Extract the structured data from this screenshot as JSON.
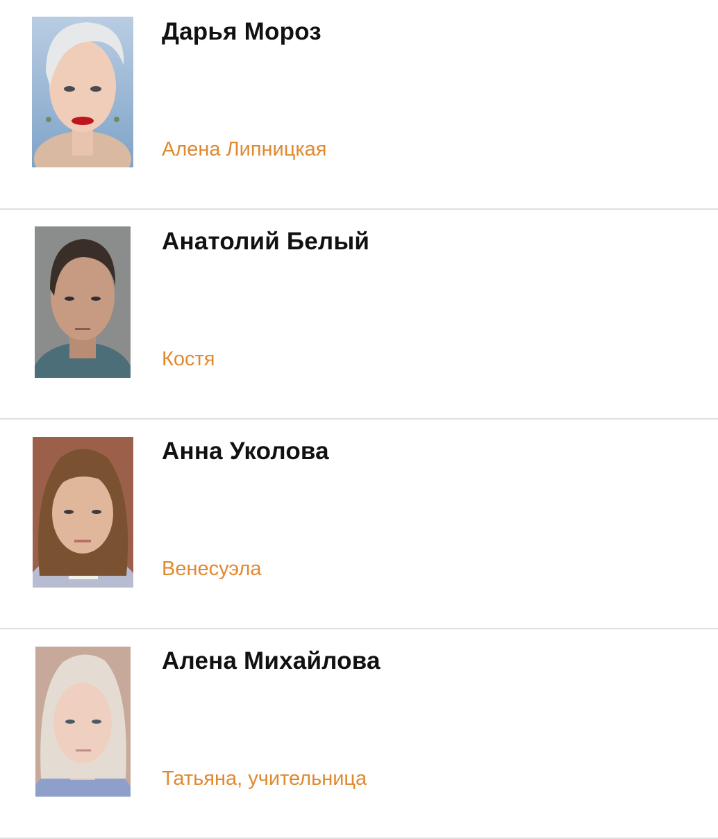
{
  "theme": {
    "role_color": "#e0892f",
    "name_color": "#111111",
    "divider_color": "#dedede"
  },
  "cast": [
    {
      "actor": "Дарья Мороз",
      "role": "Алена Липницкая"
    },
    {
      "actor": "Анатолий Белый",
      "role": "Костя"
    },
    {
      "actor": "Анна Уколова",
      "role": "Венесуэла"
    },
    {
      "actor": "Алена Михайлова",
      "role": "Татьяна, учительница"
    }
  ]
}
